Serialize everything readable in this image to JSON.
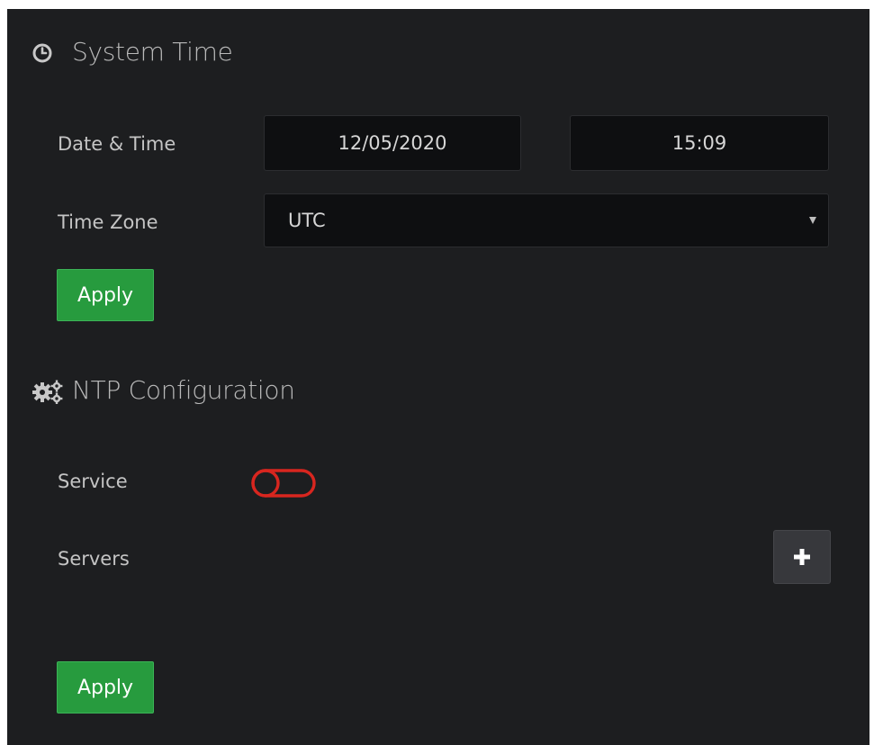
{
  "system_time": {
    "title": "System Time",
    "icon": "clock-icon",
    "date_time_label": "Date & Time",
    "date_value": "12/05/2020",
    "time_value": "15:09",
    "time_zone_label": "Time Zone",
    "time_zone_value": "UTC",
    "apply_label": "Apply"
  },
  "ntp": {
    "title": "NTP Configuration",
    "icon": "gears-icon",
    "service_label": "Service",
    "service_enabled": false,
    "servers_label": "Servers",
    "add_icon": "plus-icon",
    "apply_label": "Apply"
  },
  "colors": {
    "background": "#1d1e20",
    "field": "#0e0f11",
    "apply_green": "#279b3e",
    "toggle_off": "#d8261f",
    "add_button": "#37383c"
  }
}
